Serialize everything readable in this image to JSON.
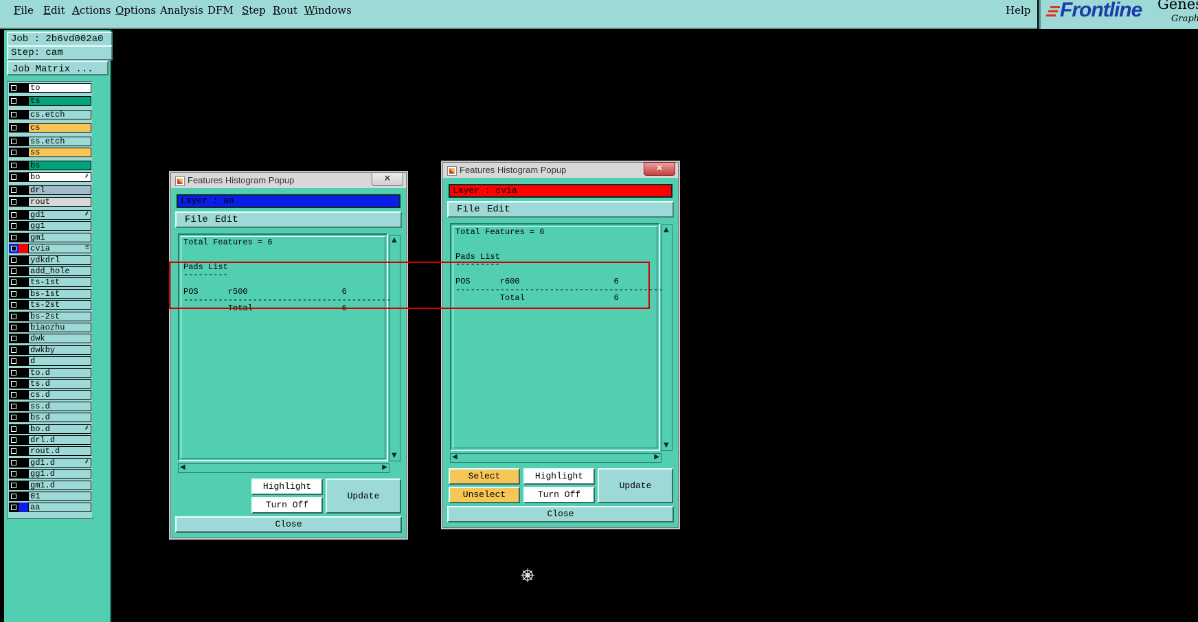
{
  "menubar": {
    "items": [
      {
        "id": "file",
        "label": "File",
        "u": "F",
        "rest": "ile"
      },
      {
        "id": "edit",
        "label": "Edit",
        "u": "E",
        "rest": "dit"
      },
      {
        "id": "actions",
        "label": "Actions",
        "u": "A",
        "rest": "ctions"
      },
      {
        "id": "options",
        "label": "Options",
        "u": "O",
        "rest": "ptions"
      },
      {
        "id": "analysis",
        "label": "Analysis",
        "u": "",
        "rest": "Analysis"
      },
      {
        "id": "dfm",
        "label": "DFM",
        "u": "",
        "rest": "DFM"
      },
      {
        "id": "step",
        "label": "Step",
        "u": "S",
        "rest": "tep"
      },
      {
        "id": "rout",
        "label": "Rout",
        "u": "R",
        "rest": "out"
      },
      {
        "id": "windows",
        "label": "Windows",
        "u": "W",
        "rest": "indows"
      }
    ],
    "help": "Help"
  },
  "brand": {
    "logo": "Frontline",
    "product": "Genes",
    "sub": "Graph"
  },
  "leftpanel": {
    "job": "Job : 2b6vd002a0",
    "step": "Step: cam",
    "job_matrix": "Job Matrix ...",
    "layers": [
      {
        "name": "to",
        "color": "#ffffff",
        "mark": ""
      },
      {
        "name": "ts",
        "color": "#00a37a",
        "mark": ""
      },
      {
        "name": "cs.etch",
        "color": "#9dd9d6",
        "mark": ""
      },
      {
        "name": "cs",
        "color": "#f7c657",
        "mark": ""
      },
      {
        "name": "ss.etch",
        "color": "#9dd9d6",
        "mark": ""
      },
      {
        "name": "ss",
        "color": "#f7c657",
        "mark": ""
      },
      {
        "name": "bs",
        "color": "#00a37a",
        "mark": ""
      },
      {
        "name": "bo",
        "color": "#ffffff",
        "mark": "⸙"
      },
      {
        "name": "drl",
        "color": "#a3bcc7",
        "mark": ""
      },
      {
        "name": "rout",
        "color": "#d8d8d8",
        "mark": ""
      },
      {
        "name": "gd1",
        "color": "#9dd9d6",
        "mark": "⸙"
      },
      {
        "name": "gg1",
        "color": "#9dd9d6",
        "mark": ""
      },
      {
        "name": "gm1",
        "color": "#9dd9d6",
        "mark": ""
      },
      {
        "name": "cvia",
        "color": "#9dd9d6",
        "mark": "≡"
      },
      {
        "name": "ydkdrl",
        "color": "#9dd9d6",
        "mark": ""
      },
      {
        "name": "add_hole",
        "color": "#9dd9d6",
        "mark": ""
      },
      {
        "name": "ts-1st",
        "color": "#9dd9d6",
        "mark": ""
      },
      {
        "name": "bs-1st",
        "color": "#9dd9d6",
        "mark": ""
      },
      {
        "name": "ts-2st",
        "color": "#9dd9d6",
        "mark": ""
      },
      {
        "name": "bs-2st",
        "color": "#9dd9d6",
        "mark": ""
      },
      {
        "name": "biaozhu",
        "color": "#9dd9d6",
        "mark": ""
      },
      {
        "name": "dwk",
        "color": "#9dd9d6",
        "mark": ""
      },
      {
        "name": "dwkby",
        "color": "#9dd9d6",
        "mark": ""
      },
      {
        "name": "d",
        "color": "#9dd9d6",
        "mark": ""
      },
      {
        "name": "to.d",
        "color": "#9dd9d6",
        "mark": ""
      },
      {
        "name": "ts.d",
        "color": "#9dd9d6",
        "mark": ""
      },
      {
        "name": "cs.d",
        "color": "#9dd9d6",
        "mark": ""
      },
      {
        "name": "ss.d",
        "color": "#9dd9d6",
        "mark": ""
      },
      {
        "name": "bs.d",
        "color": "#9dd9d6",
        "mark": ""
      },
      {
        "name": "bo.d",
        "color": "#9dd9d6",
        "mark": "⸙"
      },
      {
        "name": "drl.d",
        "color": "#9dd9d6",
        "mark": ""
      },
      {
        "name": "rout.d",
        "color": "#9dd9d6",
        "mark": ""
      },
      {
        "name": "gd1.d",
        "color": "#9dd9d6",
        "mark": "⸙"
      },
      {
        "name": "gg1.d",
        "color": "#9dd9d6",
        "mark": ""
      },
      {
        "name": "gm1.d",
        "color": "#9dd9d6",
        "mark": ""
      },
      {
        "name": "01",
        "color": "#9dd9d6",
        "mark": ""
      },
      {
        "name": "aa",
        "color": "#9dd9d6",
        "mark": ""
      }
    ]
  },
  "popup_left": {
    "title": "Features Histogram Popup",
    "close_x": "✕",
    "layer": "Layer :  aa",
    "layer_color": "#0a1ee6",
    "menu_file": "File",
    "menu_edit": "Edit",
    "lines": [
      "Total Features = 6",
      "",
      "Pads List",
      "---------",
      "",
      "POS      r500                   6",
      "------------------------------------------",
      "         Total                  6"
    ],
    "btn_highlight": "Highlight",
    "btn_turnoff": "Turn Off",
    "btn_update": "Update",
    "btn_close": "Close"
  },
  "popup_right": {
    "title": "Features Histogram Popup",
    "close_x": "✕",
    "layer": "Layer :  cvia",
    "layer_color": "#ff0000",
    "menu_file": "File",
    "menu_edit": "Edit",
    "lines": [
      "Total Features = 6",
      "",
      "Pads List",
      "---------",
      "",
      "POS      r600                   6",
      "------------------------------------------",
      "         Total                  6"
    ],
    "btn_select": "Select",
    "btn_unselect": "Unselect",
    "btn_highlight": "Highlight",
    "btn_turnoff": "Turn Off",
    "btn_update": "Update",
    "btn_close": "Close"
  },
  "colors": {
    "accent": "#52ceb0",
    "menubar": "#9dd9d6",
    "highlight_box": "#d00000",
    "select_button": "#f7c657"
  }
}
